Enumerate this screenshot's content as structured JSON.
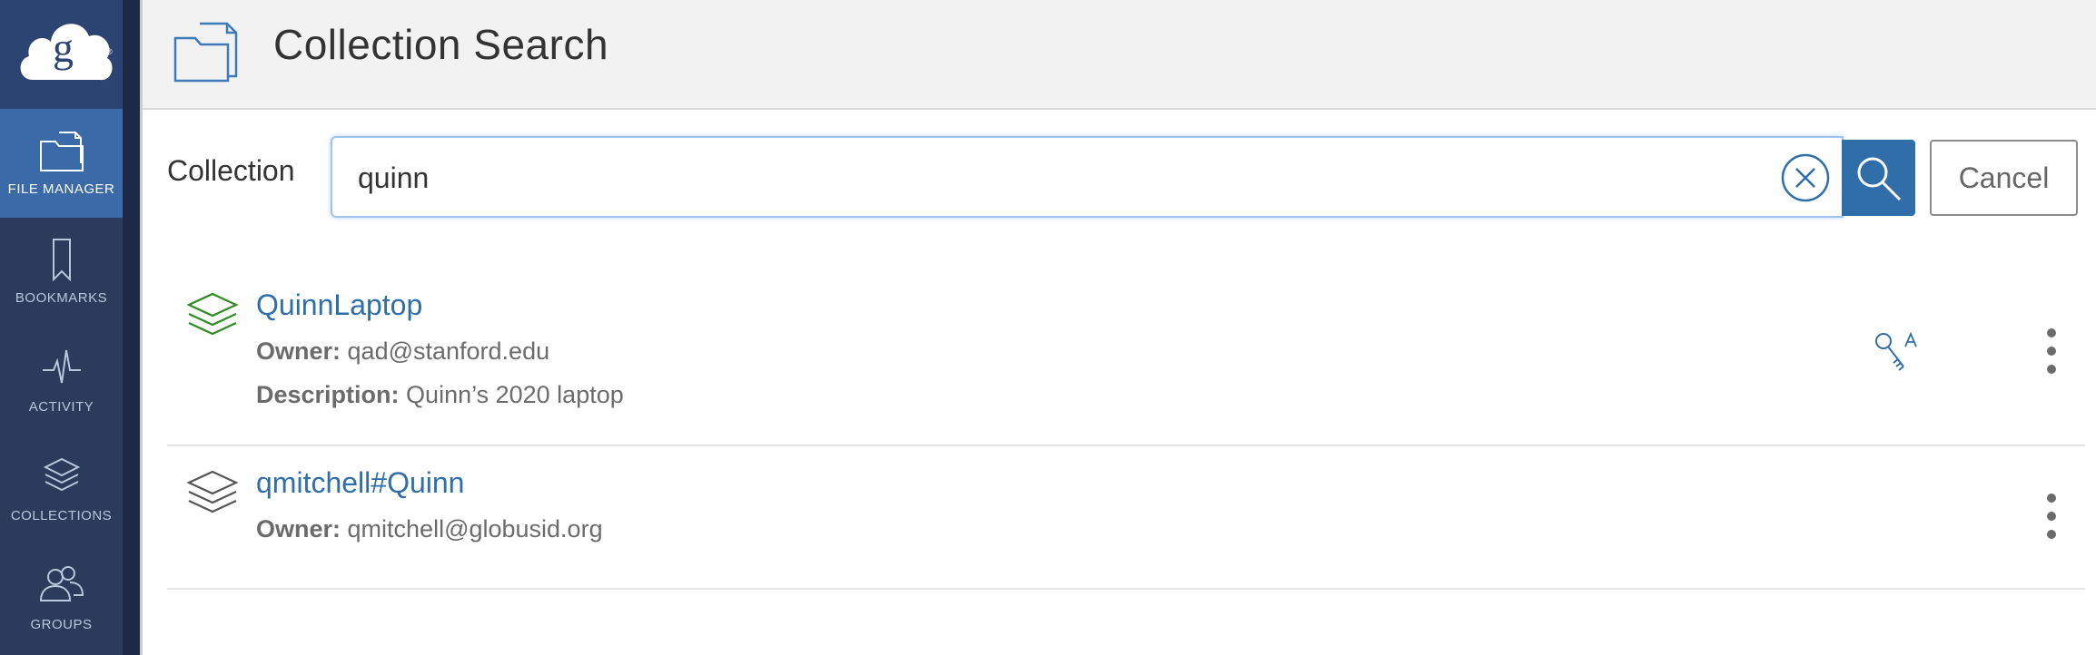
{
  "page": {
    "title": "Collection Search"
  },
  "sidebar": {
    "logo": "globus-logo",
    "items": [
      {
        "label": "FILE MANAGER",
        "icon": "file-manager-icon",
        "active": true
      },
      {
        "label": "BOOKMARKS",
        "icon": "bookmark-icon",
        "active": false
      },
      {
        "label": "ACTIVITY",
        "icon": "activity-icon",
        "active": false
      },
      {
        "label": "COLLECTIONS",
        "icon": "collections-icon",
        "active": false
      },
      {
        "label": "GROUPS",
        "icon": "groups-icon",
        "active": false
      }
    ]
  },
  "search": {
    "label": "Collection",
    "value": "quinn",
    "clear_icon": "clear-icon",
    "search_icon": "search-icon",
    "cancel_label": "Cancel"
  },
  "results": [
    {
      "name": "QuinnLaptop",
      "icon_color": "#2e8b22",
      "owner_label": "Owner:",
      "owner": "qad@stanford.edu",
      "description_label": "Description:",
      "description": "Quinn’s 2020 laptop",
      "badge_icon": "key-icon"
    },
    {
      "name": "qmitchell#Quinn",
      "icon_color": "#555555",
      "owner_label": "Owner:",
      "owner": "qmitchell@globusid.org"
    }
  ],
  "colors": {
    "sidebar_bg": "#2a3b5c",
    "sidebar_active": "#3a6aa8",
    "link_blue": "#2f6ea8",
    "header_bg": "#f2f2f2"
  }
}
